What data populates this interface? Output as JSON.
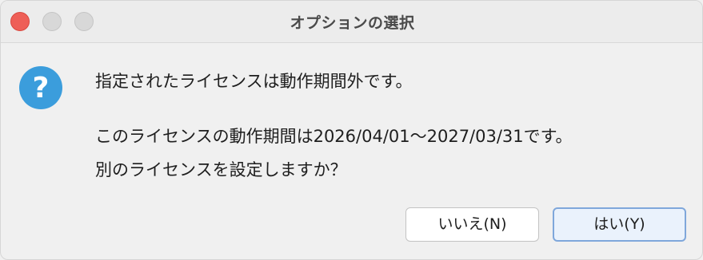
{
  "window": {
    "title": "オプションの選択"
  },
  "message": {
    "line1": "指定されたライセンスは動作期間外です。",
    "line2": "このライセンスの動作期間は2026/04/01～2027/03/31です。",
    "line3": "別のライセンスを設定しますか？"
  },
  "buttons": {
    "no_label": "いいえ(N)",
    "yes_label": "はい(Y)"
  },
  "icons": {
    "dialog_icon": "question-icon"
  },
  "colors": {
    "close": "#ee5f57",
    "icon_blue": "#3b9ddc",
    "default_button_border": "#7fa7db"
  }
}
